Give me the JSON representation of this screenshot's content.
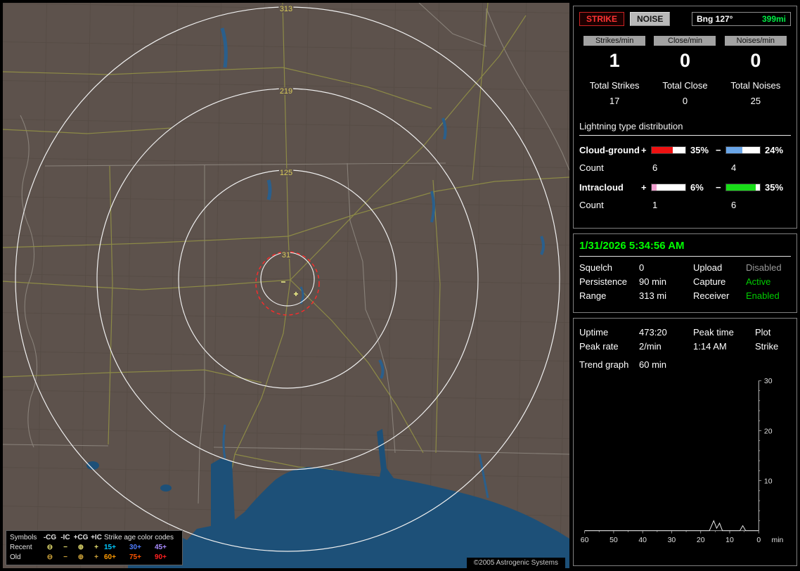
{
  "map": {
    "ring_labels": [
      "313",
      "219",
      "125",
      "31"
    ],
    "copyright": "©2005 Astrogenic Systems",
    "legend": {
      "symbols_header": "Symbols",
      "col_headers": [
        "-CG",
        "-IC",
        "+CG",
        "+IC"
      ],
      "age_header": "Strike age color codes",
      "rows": [
        {
          "label": "Recent",
          "symbol_color": "#e8e070",
          "symbols": [
            "⊖",
            "−",
            "⊕",
            "+"
          ],
          "ages": [
            {
              "label": "15+",
              "color": "#00c8ff"
            },
            {
              "label": "30+",
              "color": "#4f7dff"
            },
            {
              "label": "45+",
              "color": "#a98cff"
            }
          ]
        },
        {
          "label": "Old",
          "symbol_color": "#cfa43a",
          "symbols": [
            "⊖",
            "−",
            "⊕",
            "+"
          ],
          "ages": [
            {
              "label": "60+",
              "color": "#ff9a00"
            },
            {
              "label": "75+",
              "color": "#ff5400"
            },
            {
              "label": "90+",
              "color": "#ff2020"
            }
          ]
        }
      ]
    }
  },
  "header": {
    "strike_label": "STRIKE",
    "noise_label": "NOISE",
    "bearing": "Bng 127°",
    "distance": "399mi"
  },
  "stats": {
    "rate_headers": [
      "Strikes/min",
      "Close/min",
      "Noises/min"
    ],
    "rates": [
      "1",
      "0",
      "0"
    ],
    "total_labels": [
      "Total Strikes",
      "Total Close",
      "Total Noises"
    ],
    "totals": [
      "17",
      "0",
      "25"
    ],
    "distribution_title": "Lightning type distribution",
    "signs": {
      "plus": "+",
      "minus": "−"
    },
    "cloud_ground": {
      "label": "Cloud-ground",
      "plus_pct": "35%",
      "minus_pct": "24%",
      "plus_fill": "62%",
      "minus_fill": "48%",
      "plus_color": "#ee1111",
      "minus_color": "#6aa6e8",
      "count_label": "Count",
      "plus_count": "6",
      "minus_count": "4"
    },
    "intracloud": {
      "label": "Intracloud",
      "plus_pct": "6%",
      "minus_pct": "35%",
      "plus_fill": "14%",
      "minus_fill": "88%",
      "plus_color": "#f2a0d0",
      "minus_color": "#18dd18",
      "count_label": "Count",
      "plus_count": "1",
      "minus_count": "6"
    }
  },
  "status": {
    "datetime": "1/31/2026 5:34:56 AM",
    "rows": [
      {
        "l1": "Squelch",
        "v1": "0",
        "l2": "Upload",
        "v2": "Disabled",
        "v2_color": "#9a9a9a"
      },
      {
        "l1": "Persistence",
        "v1": "90 min",
        "l2": "Capture",
        "v2": "Active",
        "v2_color": "#00cc00"
      },
      {
        "l1": "Range",
        "v1": "313 mi",
        "l2": "Receiver",
        "v2": "Enabled",
        "v2_color": "#00cc00"
      }
    ]
  },
  "trend": {
    "grid": [
      [
        "Uptime",
        "473:20",
        "Peak time",
        "Plot"
      ],
      [
        "Peak rate",
        "2/min",
        "1:14 AM",
        "Strike"
      ]
    ],
    "graph_label": "Trend graph",
    "graph_value": "60 min"
  },
  "chart_data": {
    "type": "line",
    "title": "Trend graph",
    "window": "60 min",
    "xlabel": "min",
    "x_ticks": [
      60,
      50,
      40,
      30,
      20,
      10,
      0
    ],
    "y_ticks": [
      10,
      20,
      30
    ],
    "ylim": [
      0,
      30
    ],
    "x_direction": "60 min ago at left, 0 (now) at right; y axis drawn on right side",
    "series": [
      {
        "name": "Strike",
        "points": [
          [
            60,
            0
          ],
          [
            17,
            0
          ],
          [
            15.5,
            2
          ],
          [
            14.5,
            0.5
          ],
          [
            13.5,
            1.5
          ],
          [
            12.5,
            0
          ],
          [
            6.5,
            0
          ],
          [
            5.5,
            1
          ],
          [
            4.5,
            0
          ],
          [
            0,
            0
          ]
        ]
      }
    ]
  }
}
